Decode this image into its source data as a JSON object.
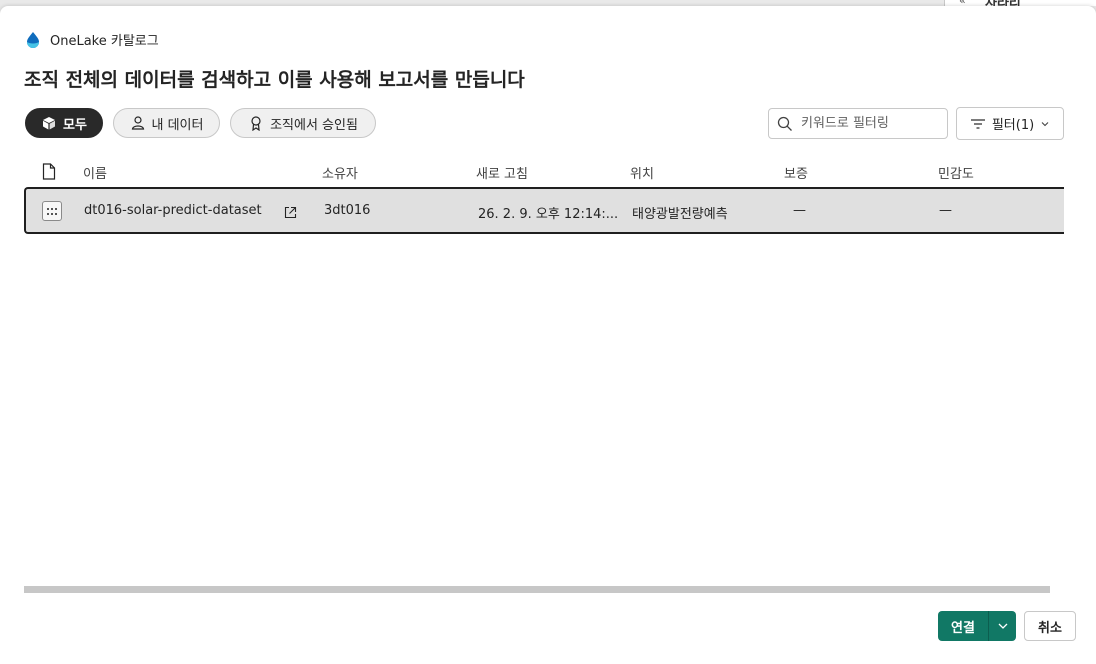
{
  "backdrop": {
    "text": "사라리"
  },
  "header": {
    "app_name": "OneLake 카탈로그",
    "title": "조직 전체의 데이터를 검색하고 이를 사용해 보고서를 만듭니다"
  },
  "filters": {
    "pills": [
      {
        "label": "모두",
        "active": true,
        "icon": "cube-icon"
      },
      {
        "label": "내 데이터",
        "active": false,
        "icon": "person-icon"
      },
      {
        "label": "조직에서 승인됨",
        "active": false,
        "icon": "ribbon-icon"
      }
    ],
    "search_placeholder": "키워드로 필터링",
    "filter_button_label": "필터(1)"
  },
  "table": {
    "columns": [
      "이름",
      "소유자",
      "새로 고침",
      "위치",
      "보증",
      "민감도"
    ],
    "rows": [
      {
        "name": "dt016-solar-predict-dataset",
        "owner": "3dt016",
        "refresh": "26. 2. 9. 오후 12:14:...",
        "location": "태양광발전량예측",
        "endorsement": "—",
        "sensitivity": "—"
      }
    ]
  },
  "footer": {
    "connect_label": "연결",
    "cancel_label": "취소"
  },
  "colors": {
    "accent": "#117865",
    "active_pill": "#292929",
    "row_selected": "#e0e0e0"
  }
}
